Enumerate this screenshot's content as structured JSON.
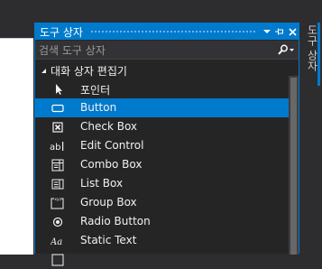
{
  "toolbox": {
    "title": "도구 상자",
    "search_placeholder": "검색 도구 상자",
    "group": {
      "label": "대화 상자 편집기",
      "expanded": true
    },
    "items": [
      {
        "label": "포인터",
        "icon": "pointer-icon",
        "selected": false
      },
      {
        "label": "Button",
        "icon": "button-icon",
        "selected": true
      },
      {
        "label": "Check Box",
        "icon": "checkbox-icon",
        "selected": false
      },
      {
        "label": "Edit Control",
        "icon": "edit-control-icon",
        "selected": false
      },
      {
        "label": "Combo Box",
        "icon": "combo-box-icon",
        "selected": false
      },
      {
        "label": "List Box",
        "icon": "list-box-icon",
        "selected": false
      },
      {
        "label": "Group Box",
        "icon": "group-box-icon",
        "selected": false
      },
      {
        "label": "Radio Button",
        "icon": "radio-button-icon",
        "selected": false
      },
      {
        "label": "Static Text",
        "icon": "static-text-icon",
        "selected": false
      }
    ]
  },
  "side_tab": {
    "label": "도구 상자"
  },
  "colors": {
    "accent": "#007acc",
    "panel_bg": "#252526",
    "text": "#f1f1f1",
    "placeholder": "#999999"
  }
}
